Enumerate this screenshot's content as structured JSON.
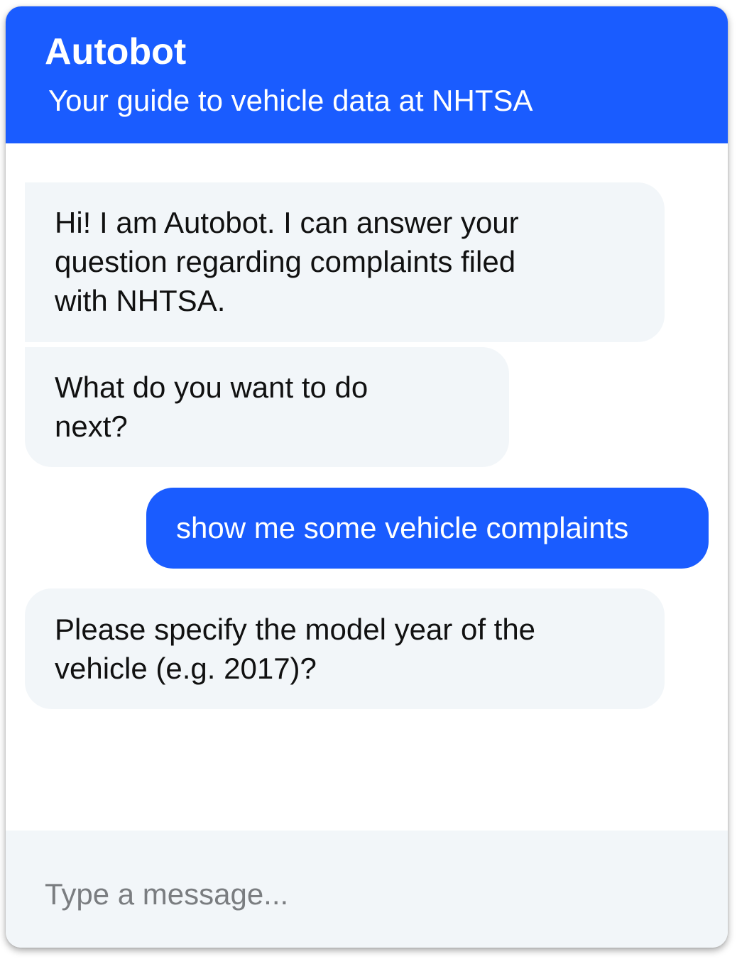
{
  "header": {
    "title": "Autobot",
    "subtitle": "Your guide to vehicle data at NHTSA"
  },
  "messages": [
    {
      "sender": "bot",
      "text": "Hi! I am Autobot. I can answer your\nquestion regarding complaints filed\nwith NHTSA."
    },
    {
      "sender": "bot",
      "text": "What do you want to do\nnext?"
    },
    {
      "sender": "user",
      "text": "show me some vehicle complaints"
    },
    {
      "sender": "bot",
      "text": "Please specify the model year of the\nvehicle (e.g. 2017)?"
    }
  ],
  "input": {
    "placeholder": "Type a message...",
    "value": ""
  },
  "colors": {
    "accent": "#1a5cff",
    "bot_bubble": "#f2f6f9",
    "input_bar": "#f2f6f9"
  }
}
